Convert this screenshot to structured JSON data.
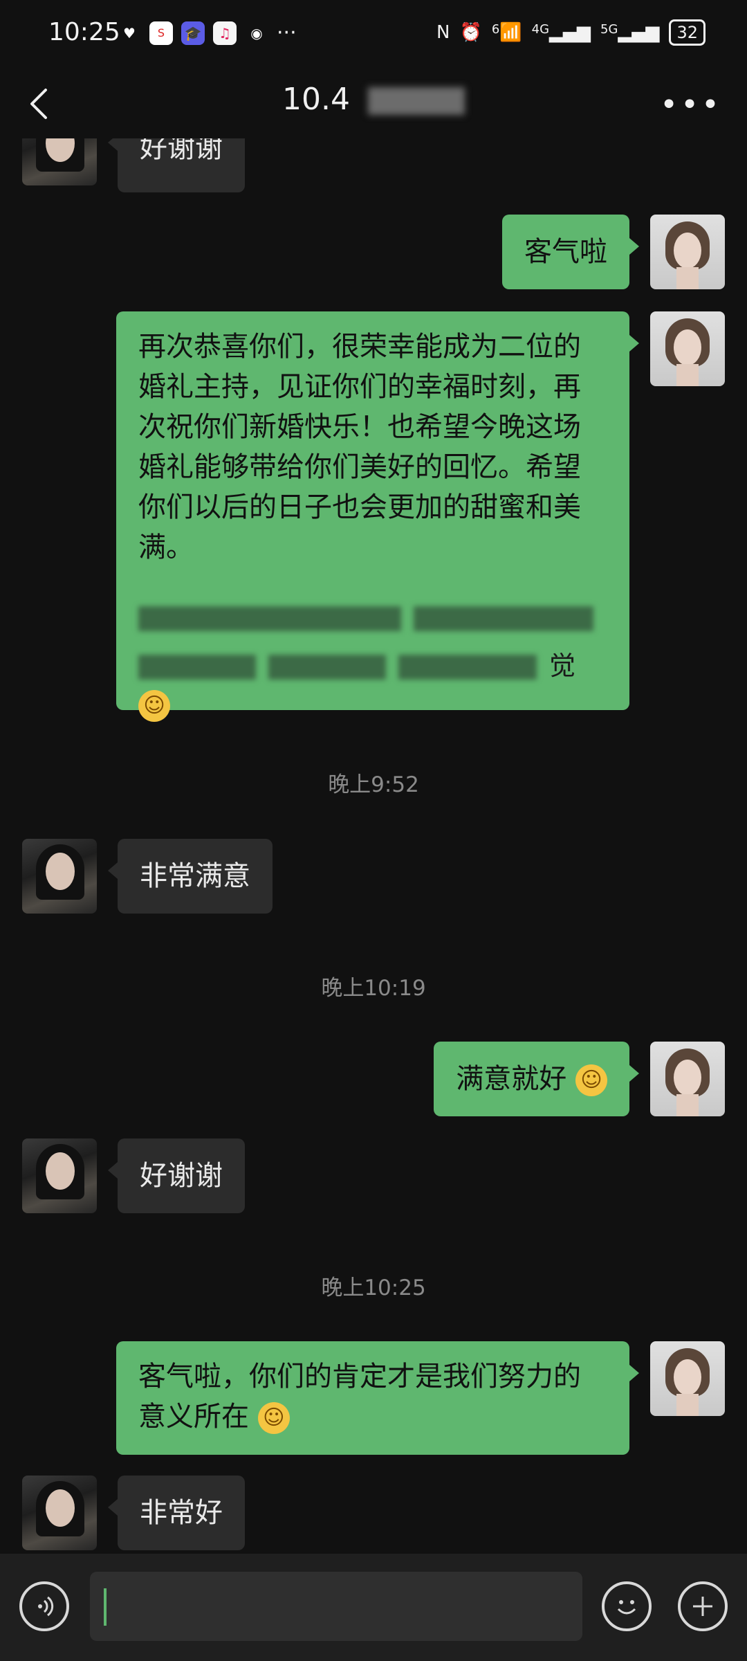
{
  "status_bar": {
    "time": "10:25",
    "app_icons": [
      "heart-icon",
      "sina-icon",
      "graduation-cap-icon",
      "music-icon",
      "qq-icon"
    ],
    "more_dots": "···",
    "network_labels": [
      "N",
      "6",
      "4G",
      "5G"
    ],
    "battery": "32"
  },
  "header": {
    "title": "10.4"
  },
  "messages": [
    {
      "side": "left",
      "text": "好谢谢"
    },
    {
      "side": "right",
      "text": "客气啦"
    },
    {
      "side": "right",
      "text": "再次恭喜你们，很荣幸能成为二位的婚礼主持，见证你们的幸福时刻，再次祝你们新婚快乐！也希望今晚这场婚礼能够带给你们美好的回忆。希望你们以后的日子也会更加的甜蜜和美满。"
    },
    {
      "type": "time",
      "text": "晚上9:52"
    },
    {
      "side": "left",
      "text": "非常满意"
    },
    {
      "type": "time",
      "text": "晚上10:19"
    },
    {
      "side": "right",
      "text": "满意就好"
    },
    {
      "side": "left",
      "text": "好谢谢"
    },
    {
      "type": "time",
      "text": "晚上10:25"
    },
    {
      "side": "right",
      "text": "客气啦，你们的肯定才是我们努力的意义所在"
    },
    {
      "side": "left",
      "text": "非常好"
    }
  ],
  "blurred_fragment": "觉",
  "colors": {
    "background": "#111111",
    "bubble_sent": "#5fb76f",
    "bubble_received": "#2c2c2c",
    "timestamp": "#8a8a8a"
  }
}
